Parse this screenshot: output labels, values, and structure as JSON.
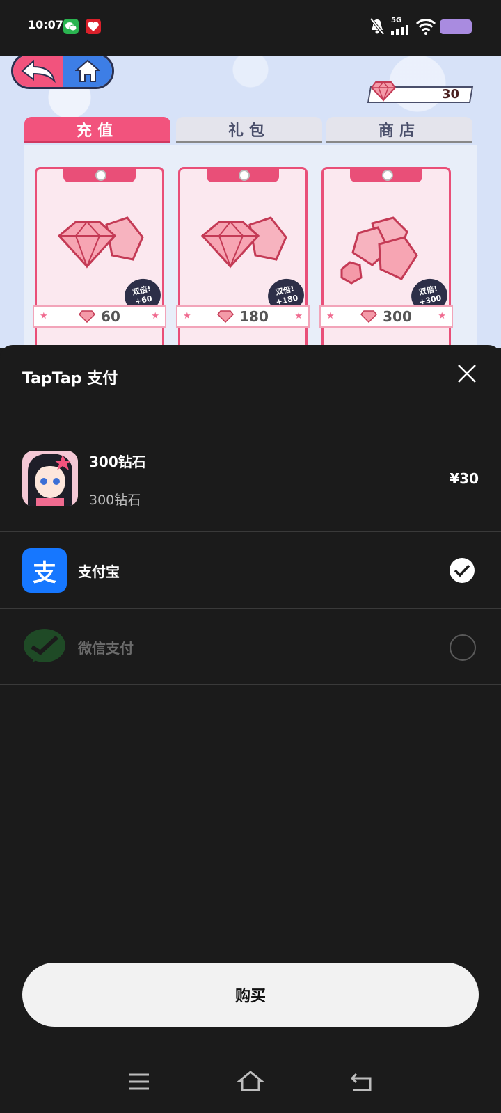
{
  "status_bar": {
    "time": "10:07",
    "network": "5G",
    "icons": [
      "wechat-notification-icon",
      "gift-notification-icon",
      "mute-icon",
      "signal-icon",
      "wifi-icon",
      "battery-icon"
    ],
    "battery_color": "#a98be0"
  },
  "game": {
    "gem_balance": "30",
    "tabs": [
      {
        "label": "充值",
        "active": true
      },
      {
        "label": "礼包",
        "active": false
      },
      {
        "label": "商店",
        "active": false
      }
    ],
    "products": [
      {
        "amount": "60",
        "bonus_line1": "双倍!",
        "bonus_line2": "+60"
      },
      {
        "amount": "180",
        "bonus_line1": "双倍!",
        "bonus_line2": "+180"
      },
      {
        "amount": "300",
        "bonus_line1": "双倍!",
        "bonus_line2": "+300"
      }
    ],
    "accent_color": "#f2537d"
  },
  "sheet": {
    "title": "TapTap 支付",
    "product": {
      "name": "300钻石",
      "description": "300钻石",
      "price": "¥30"
    },
    "payment_methods": [
      {
        "label": "支付宝",
        "logo_glyph": "支",
        "selected": true,
        "color": "#1677ff"
      },
      {
        "label": "微信支付",
        "selected": false,
        "color": "#2a8a3a"
      }
    ],
    "buy_label": "购买"
  },
  "nav_bar": {
    "icons": [
      "menu-icon",
      "home-icon",
      "back-icon"
    ]
  }
}
